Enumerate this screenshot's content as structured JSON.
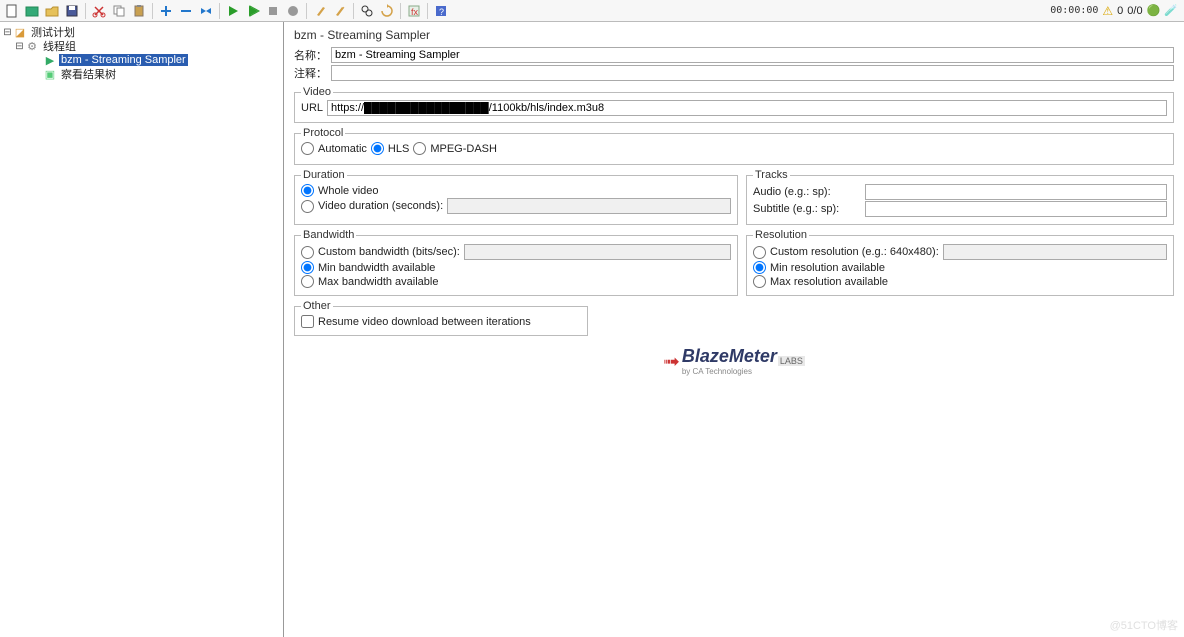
{
  "toolbar_right": {
    "timer": "00:00:00",
    "warn_count": "0",
    "ratio": "0/0"
  },
  "tree": {
    "root": "测试计划",
    "thread_group": "线程组",
    "sampler": "bzm - Streaming Sampler",
    "results": "察看结果树"
  },
  "panel": {
    "title": "bzm - Streaming Sampler",
    "name_label": "名称：",
    "name_value": "bzm - Streaming Sampler",
    "comment_label": "注释：",
    "comment_value": ""
  },
  "video": {
    "legend": "Video",
    "url_label": "URL",
    "url_value": "https://████████████████/1100kb/hls/index.m3u8"
  },
  "protocol": {
    "legend": "Protocol",
    "auto": "Automatic",
    "hls": "HLS",
    "dash": "MPEG-DASH",
    "selected": "hls"
  },
  "duration": {
    "legend": "Duration",
    "whole": "Whole video",
    "partial": "Video duration (seconds):",
    "seconds": "",
    "selected": "whole"
  },
  "tracks": {
    "legend": "Tracks",
    "audio_label": "Audio (e.g.: sp): ",
    "audio_value": "",
    "sub_label": "Subtitle (e.g.: sp): ",
    "sub_value": ""
  },
  "bandwidth": {
    "legend": "Bandwidth",
    "custom": "Custom bandwidth (bits/sec): ",
    "custom_value": "",
    "min": "Min bandwidth available",
    "max": "Max bandwidth available",
    "selected": "min"
  },
  "resolution": {
    "legend": "Resolution",
    "custom": "Custom resolution (e.g.: 640x480): ",
    "custom_value": "",
    "min": "Min resolution available",
    "max": "Max resolution available",
    "selected": "min"
  },
  "other": {
    "legend": "Other",
    "resume": "Resume video download between iterations",
    "resume_checked": false
  },
  "logo": {
    "brand": "BlazeMeter",
    "by": "by CA Technologies",
    "labs": "LABS"
  },
  "watermark": "@51CTO博客"
}
